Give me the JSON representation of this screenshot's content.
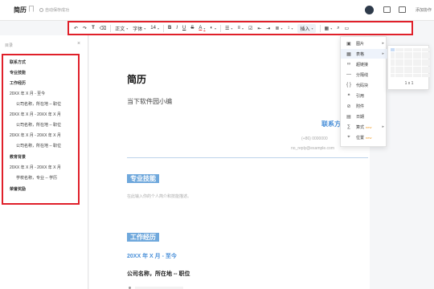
{
  "topbar": {
    "doc_title": "简历",
    "save_status": "自动保存成功",
    "add_collaborator": "添加协作"
  },
  "toolbar": {
    "undo": "↶",
    "redo": "↷",
    "format_painter": "T",
    "clear_format": "⌫",
    "paragraph_style": "正文",
    "font_family": "字体",
    "font_size": "14",
    "bold": "B",
    "italic": "I",
    "underline": "U",
    "strikethrough": "S",
    "font_color": "A",
    "highlight": "◐",
    "insert": "插入"
  },
  "sidebar": {
    "header": "目录",
    "items": [
      {
        "label": "联系方式",
        "level": 1
      },
      {
        "label": "专业技能",
        "level": 1
      },
      {
        "label": "工作经历",
        "level": 1
      },
      {
        "label": "20XX 年 X 月 - 至今",
        "level": 2
      },
      {
        "label": "公司名称，所在地 -- 职位",
        "level": 3
      },
      {
        "label": "20XX 年 X 月 - 20XX 年 X 月",
        "level": 2
      },
      {
        "label": "公司名称，所在地 -- 职位",
        "level": 3
      },
      {
        "label": "20XX 年 X 月 - 20XX 年 X 月",
        "level": 2
      },
      {
        "label": "公司名称，所在地 -- 职位",
        "level": 3
      },
      {
        "label": "教育背景",
        "level": 1
      },
      {
        "label": "20XX 年 X 月 - 20XX 年 X 月",
        "level": 2
      },
      {
        "label": "学校名称，专业 -- 学历",
        "level": 3
      },
      {
        "label": "荣誉奖励",
        "level": 1
      }
    ]
  },
  "document": {
    "title": "简历",
    "subtitle": "当下软件园小编",
    "contact_heading": "联系方",
    "contact_phone": "(+86) 0000000",
    "contact_email": "no_reply@example.com",
    "skills_heading": "专业技能",
    "skills_placeholder": "在此输入你的个人简介和技能描述。",
    "work_heading": "工作经历",
    "work_period": "20XX 年 X 月 - 至今",
    "work_company": "公司名称，所在地 -- 职位"
  },
  "insert_menu": {
    "items": [
      {
        "icon": "image-icon",
        "glyph": "▣",
        "label": "图片",
        "submenu": true
      },
      {
        "icon": "table-icon",
        "glyph": "▦",
        "label": "表格",
        "submenu": true,
        "active": true
      },
      {
        "icon": "link-icon",
        "glyph": "∞",
        "label": "超链接"
      },
      {
        "icon": "divider-icon",
        "glyph": "—",
        "label": "分隔线"
      },
      {
        "icon": "code-icon",
        "glyph": "{ }",
        "label": "代码块"
      },
      {
        "icon": "quote-icon",
        "glyph": "❝",
        "label": "引用"
      },
      {
        "icon": "attachment-icon",
        "glyph": "⊘",
        "label": "附件"
      },
      {
        "icon": "date-icon",
        "glyph": "▤",
        "label": "日期"
      },
      {
        "icon": "formula-icon",
        "glyph": "∑",
        "label": "算式",
        "badge": "new",
        "submenu": true
      },
      {
        "icon": "location-icon",
        "glyph": "⌖",
        "label": "位置",
        "badge": "new"
      }
    ]
  },
  "table_picker": {
    "size_label": "1 x 1",
    "selected_rows": 1,
    "selected_cols": 1,
    "rows": 8,
    "cols": 9
  },
  "colors": {
    "accent": "#4a90d9",
    "section_tag": "#6fa8dc",
    "highlight_box": "#e0202a"
  }
}
